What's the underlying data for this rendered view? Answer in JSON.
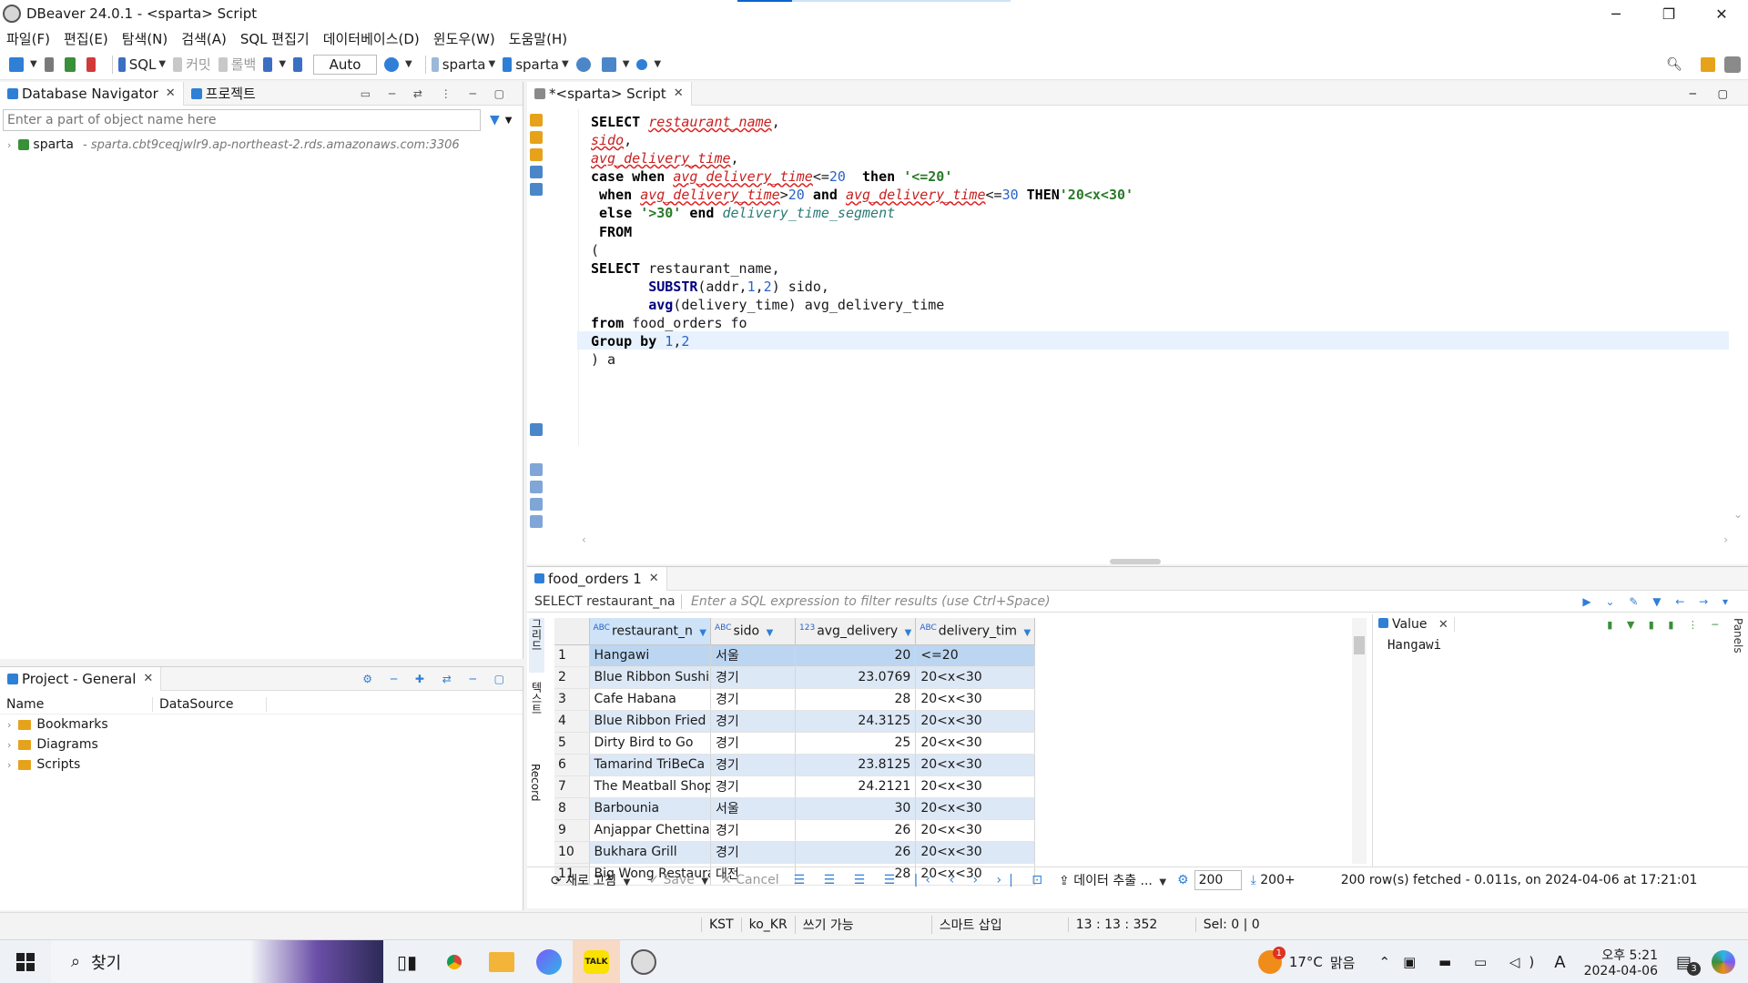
{
  "window": {
    "title": "DBeaver 24.0.1 - <sparta> Script"
  },
  "menu": [
    "파일(F)",
    "편집(E)",
    "탐색(N)",
    "검색(A)",
    "SQL 편집기",
    "데이터베이스(D)",
    "윈도우(W)",
    "도움말(H)"
  ],
  "toolbar": {
    "sql_label": "SQL",
    "commit_label": "커밋",
    "rollback_label": "롤백",
    "auto_label": "Auto",
    "connection_label": "sparta",
    "schema_label": "sparta"
  },
  "navigator": {
    "tab_label": "Database Navigator",
    "project_tab_label": "프로젝트",
    "filter_placeholder": "Enter a part of object name here",
    "connection": {
      "name": "sparta",
      "host": "- sparta.cbt9ceqjwlr9.ap-northeast-2.rds.amazonaws.com:3306"
    }
  },
  "project": {
    "tab_label": "Project - General",
    "col_name": "Name",
    "col_datasource": "DataSource",
    "items": [
      "Bookmarks",
      "Diagrams",
      "Scripts"
    ]
  },
  "editor": {
    "tab_label": "*<sparta> Script",
    "lines": [
      [
        [
          "kw",
          "SELECT "
        ],
        [
          "err",
          "restaurant_name"
        ],
        [
          "t",
          ","
        ]
      ],
      [
        [
          "err",
          "sido"
        ],
        [
          "t",
          ","
        ]
      ],
      [
        [
          "err",
          "avg_delivery_time"
        ],
        [
          "t",
          ","
        ]
      ],
      [
        [
          "kw",
          "case when "
        ],
        [
          "err",
          "avg_delivery_time"
        ],
        [
          "t",
          "<="
        ],
        [
          "num",
          "20"
        ],
        [
          "t",
          "  "
        ],
        [
          "kw",
          "then "
        ],
        [
          "str",
          "'<=20'"
        ]
      ],
      [
        [
          "t",
          " "
        ],
        [
          "kw",
          "when "
        ],
        [
          "err",
          "avg_delivery_time"
        ],
        [
          "t",
          ">"
        ],
        [
          "num",
          "20"
        ],
        [
          "t",
          " "
        ],
        [
          "kw",
          "and "
        ],
        [
          "err",
          "avg_delivery_time"
        ],
        [
          "t",
          "<="
        ],
        [
          "num",
          "30"
        ],
        [
          "t",
          " "
        ],
        [
          "kw",
          "THEN"
        ],
        [
          "str",
          "'20<x<30'"
        ]
      ],
      [
        [
          "t",
          " "
        ],
        [
          "kw",
          "else "
        ],
        [
          "str",
          "'>30'"
        ],
        [
          "t",
          " "
        ],
        [
          "kw",
          "end "
        ],
        [
          "alias",
          "delivery_time_segment"
        ]
      ],
      [
        [
          "t",
          " "
        ],
        [
          "kw",
          "FROM"
        ]
      ],
      [
        [
          "t",
          "("
        ]
      ],
      [
        [
          "kw",
          "SELECT "
        ],
        [
          "t",
          "restaurant_name,"
        ]
      ],
      [
        [
          "t",
          "       "
        ],
        [
          "fn",
          "SUBSTR"
        ],
        [
          "t",
          "(addr,"
        ],
        [
          "num",
          "1"
        ],
        [
          "t",
          ","
        ],
        [
          "num",
          "2"
        ],
        [
          "t",
          ") sido,"
        ]
      ],
      [
        [
          "t",
          "       "
        ],
        [
          "fn",
          "avg"
        ],
        [
          "t",
          "(delivery_time) avg_delivery_time"
        ]
      ],
      [
        [
          "kw",
          "from "
        ],
        [
          "t",
          "food_orders fo"
        ]
      ],
      [
        [
          "kw",
          "Group by "
        ],
        [
          "num",
          "1"
        ],
        [
          "t",
          ","
        ],
        [
          "num",
          "2"
        ]
      ],
      [
        [
          "t",
          ") a"
        ]
      ]
    ]
  },
  "results": {
    "tab_label": "food_orders 1",
    "sql_chip": "SELECT restaurant_na",
    "filter_placeholder": "Enter a SQL expression to filter results (use Ctrl+Space)",
    "columns": [
      "restaurant_n",
      "sido",
      "avg_delivery",
      "delivery_tim"
    ],
    "rows": [
      [
        "1",
        "Hangawi",
        "서울",
        "20",
        "<=20"
      ],
      [
        "2",
        "Blue Ribbon Sushi I",
        "경기",
        "23.0769",
        "20<x<30"
      ],
      [
        "3",
        "Cafe Habana",
        "경기",
        "28",
        "20<x<30"
      ],
      [
        "4",
        "Blue Ribbon Fried C",
        "경기",
        "24.3125",
        "20<x<30"
      ],
      [
        "5",
        "Dirty Bird to Go",
        "경기",
        "25",
        "20<x<30"
      ],
      [
        "6",
        "Tamarind TriBeCa",
        "경기",
        "23.8125",
        "20<x<30"
      ],
      [
        "7",
        "The Meatball Shop",
        "경기",
        "24.2121",
        "20<x<30"
      ],
      [
        "8",
        "Barbounia",
        "서울",
        "30",
        "20<x<30"
      ],
      [
        "9",
        "Anjappar Chettinac",
        "경기",
        "26",
        "20<x<30"
      ],
      [
        "10",
        "Bukhara Grill",
        "경기",
        "26",
        "20<x<30"
      ],
      [
        "11",
        "Big Wong Restaura",
        "대전",
        "28",
        "20<x<30"
      ]
    ],
    "vertical_tabs": [
      "그리드",
      "텍스트",
      "Record"
    ],
    "value_panel": {
      "title": "Value",
      "value": "Hangawi",
      "side_label": "Panels"
    },
    "bottom": {
      "refresh_label": "새로 고침",
      "save_label": "Save",
      "cancel_label": "Cancel",
      "export_label": "데이터 추출 ...",
      "fetch_size": "200",
      "fetch_more": "200+",
      "status": "200 row(s) fetched - 0.011s, on 2024-04-06 at 17:21:01"
    }
  },
  "statusbar": {
    "tz": "KST",
    "locale": "ko_KR",
    "mode": "쓰기 가능",
    "insert": "스마트 삽입",
    "position": "13 : 13 : 352",
    "selection": "Sel: 0 | 0"
  },
  "taskbar": {
    "search_label": "찾기",
    "weather_temp": "17°C",
    "weather_desc": "맑음",
    "ime": "A",
    "time": "오후 5:21",
    "date": "2024-04-06",
    "notif_count": "3",
    "weather_badge": "1"
  },
  "colors": {
    "accent": "#0a64d0",
    "selected_row": "#bcd6f2",
    "alt_row": "#dce8f6",
    "error": "#c81e1e"
  }
}
